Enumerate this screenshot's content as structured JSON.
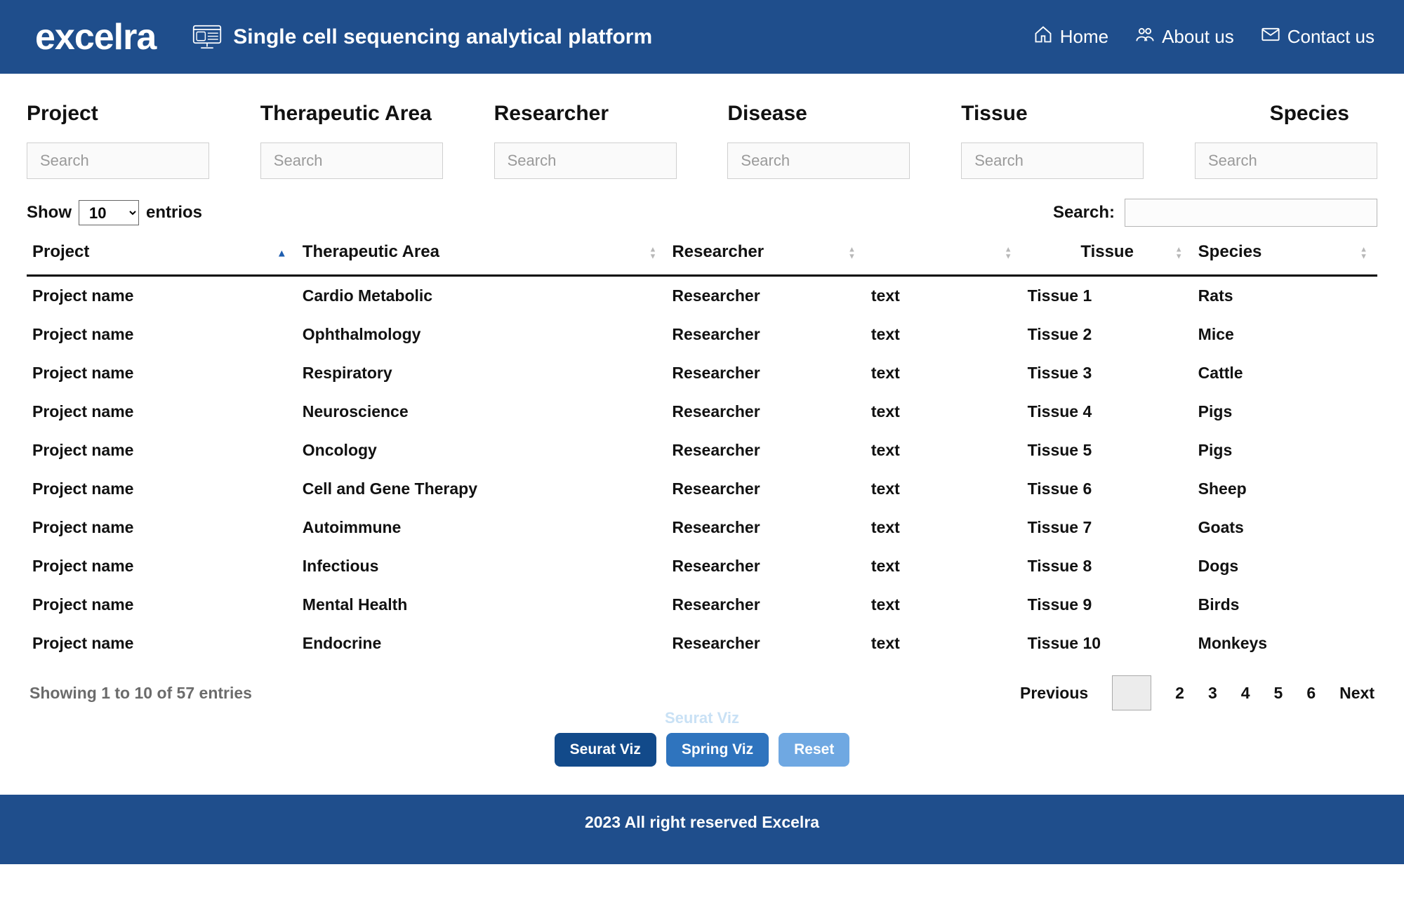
{
  "header": {
    "logo_text": "excelra",
    "app_title": "Single cell sequencing analytical platform",
    "nav": {
      "home": "Home",
      "about": "About us",
      "contact": "Contact us"
    }
  },
  "filters": {
    "labels": {
      "project": "Project",
      "therapeutic_area": "Therapeutic Area",
      "researcher": "Researcher",
      "disease": "Disease",
      "tissue": "Tissue",
      "species": "Species"
    },
    "placeholder": "Search"
  },
  "controls": {
    "show_prefix": "Show",
    "show_value": "10",
    "show_suffix": "entrios",
    "search_label": "Search:"
  },
  "table": {
    "columns": {
      "project": "Project",
      "therapeutic_area": "Therapeutic Area",
      "researcher": "Researcher",
      "disease": "",
      "tissue": "Tissue",
      "species": "Species"
    },
    "sort": {
      "column": "project",
      "dir": "asc"
    },
    "rows": [
      {
        "project": "Project name",
        "therapeutic_area": "Cardio Metabolic",
        "researcher": "Researcher",
        "disease": "text",
        "tissue": "Tissue 1",
        "species": "Rats"
      },
      {
        "project": "Project name",
        "therapeutic_area": "Ophthalmology",
        "researcher": "Researcher",
        "disease": "text",
        "tissue": "Tissue 2",
        "species": "Mice"
      },
      {
        "project": "Project name",
        "therapeutic_area": "Respiratory",
        "researcher": "Researcher",
        "disease": "text",
        "tissue": "Tissue 3",
        "species": "Cattle"
      },
      {
        "project": "Project name",
        "therapeutic_area": "Neuroscience",
        "researcher": "Researcher",
        "disease": "text",
        "tissue": "Tissue 4",
        "species": "Pigs"
      },
      {
        "project": "Project name",
        "therapeutic_area": "Oncology",
        "researcher": "Researcher",
        "disease": "text",
        "tissue": "Tissue 5",
        "species": "Pigs"
      },
      {
        "project": "Project name",
        "therapeutic_area": "Cell and Gene Therapy",
        "researcher": "Researcher",
        "disease": "text",
        "tissue": "Tissue 6",
        "species": "Sheep"
      },
      {
        "project": "Project name",
        "therapeutic_area": "Autoimmune",
        "researcher": "Researcher",
        "disease": "text",
        "tissue": "Tissue 7",
        "species": "Goats"
      },
      {
        "project": "Project name",
        "therapeutic_area": "Infectious",
        "researcher": "Researcher",
        "disease": "text",
        "tissue": "Tissue 8",
        "species": "Dogs"
      },
      {
        "project": "Project name",
        "therapeutic_area": "Mental Health",
        "researcher": "Researcher",
        "disease": "text",
        "tissue": "Tissue 9",
        "species": "Birds"
      },
      {
        "project": "Project name",
        "therapeutic_area": "Endocrine",
        "researcher": "Researcher",
        "disease": "text",
        "tissue": "Tissue 10",
        "species": "Monkeys"
      }
    ]
  },
  "footer_controls": {
    "showing": "Showing 1 to 10 of 57 entries",
    "pages": [
      "2",
      "3",
      "4",
      "5",
      "6"
    ],
    "prev": "Previous",
    "next": "Next"
  },
  "actions": {
    "ghost": "Seurat Viz",
    "seurat": "Seurat Viz",
    "spring": "Spring Viz",
    "reset": "Reset"
  },
  "page_footer": "2023 All right reserved Excelra"
}
